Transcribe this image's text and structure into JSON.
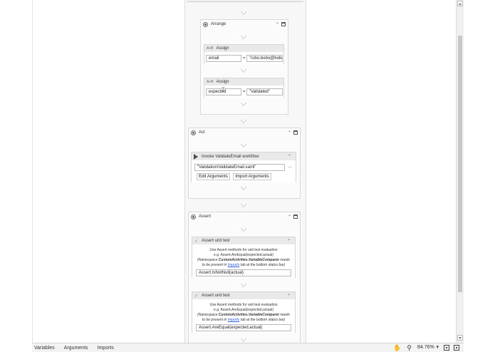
{
  "arrange": {
    "title": "Arrange",
    "assign1": {
      "title": "Assign",
      "to": "email",
      "eq": "=",
      "value": "\"robo.bobo@bobo"
    },
    "assign2": {
      "title": "Assign",
      "to": "expected",
      "eq": "=",
      "value": "\"Validated\""
    }
  },
  "act": {
    "title": "Act",
    "invoke": {
      "title": "Invoke ValidateEmail workflow",
      "path": "\"Validation\\ValidateEmail.xaml\"",
      "browse": "...",
      "edit_args": "Edit Arguments",
      "import_args": "Import Arguments"
    }
  },
  "assert": {
    "title": "Assert",
    "unit1": {
      "title": "Assert unit test",
      "note_line1": "Use Assert methods for unit test evaluation",
      "note_line2": "e.g. Assert.AreEqual(expected,actual)",
      "note_line3a": "(Namespace ",
      "note_line3b": "CustomActivities.VariableComparer",
      "note_line3c": " needs",
      "note_line4a": "to be present in ",
      "note_line4b": "Imports",
      "note_line4c": " tab at the bottom status bar)",
      "expression": "Assert.IsNotNull(actual)"
    },
    "unit2": {
      "title": "Assert unit test",
      "note_line1": "Use Assert methods for unit test evaluation",
      "note_line2": "e.g. Assert.AreEqual(expected,actual)",
      "note_line3a": "(Namespace ",
      "note_line3b": "CustomActivities.VariableComparer",
      "note_line3c": " needs",
      "note_line4a": "to be present in ",
      "note_line4b": "Imports",
      "note_line4c": " tab at the bottom status bar)",
      "expression": "Assert.AreEqual(expected,actual)"
    }
  },
  "statusbar": {
    "variables": "Variables",
    "arguments": "Arguments",
    "imports": "Imports",
    "zoom": "84.76%",
    "icons": [
      "hand-icon",
      "search-icon",
      "fit-screen-icon",
      "overview-icon"
    ]
  }
}
